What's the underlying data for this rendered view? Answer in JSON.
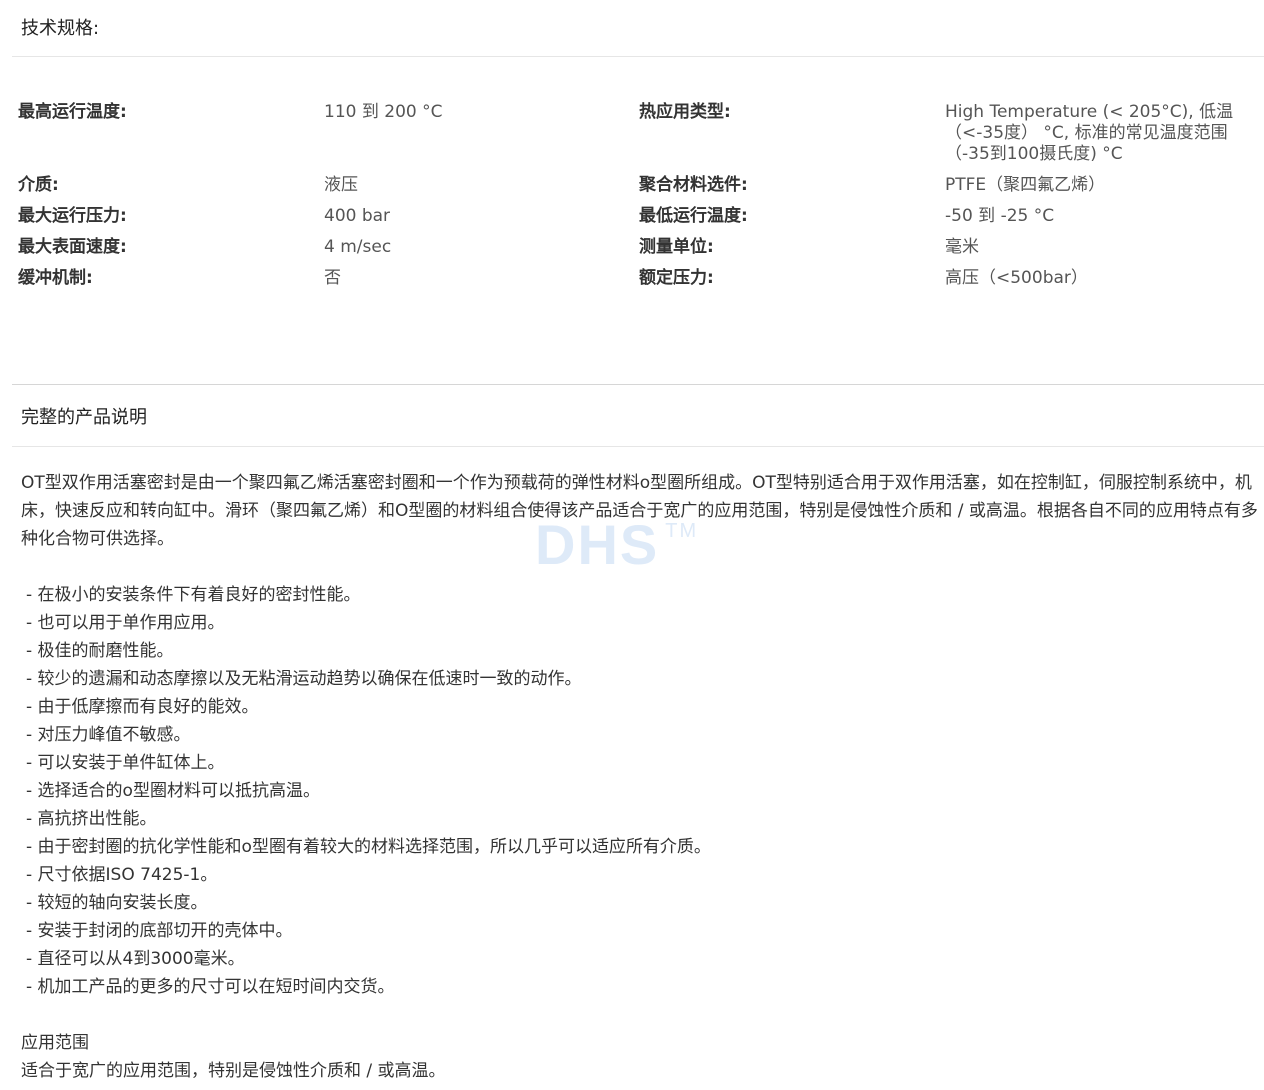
{
  "specs": {
    "heading": "技术规格:",
    "rows": [
      {
        "label1": "最高运行温度:",
        "value1": "110 到 200 °C",
        "label2": "热应用类型:",
        "value2": "High Temperature (< 205°C), 低温（<-35度） °C, 标准的常见温度范围（-35到100摄氏度) °C"
      },
      {
        "label1": "介质:",
        "value1": "液压",
        "label2": "聚合材料选件:",
        "value2": "PTFE（聚四氟乙烯）"
      },
      {
        "label1": "最大运行压力:",
        "value1": "400 bar",
        "label2": "最低运行温度:",
        "value2": "-50 到 -25 °C"
      },
      {
        "label1": "最大表面速度:",
        "value1": "4 m/sec",
        "label2": "测量单位:",
        "value2": "毫米"
      },
      {
        "label1": "缓冲机制:",
        "value1": "否",
        "label2": "额定压力:",
        "value2": "高压（<500bar）"
      }
    ]
  },
  "description": {
    "heading": "完整的产品说明",
    "intro": "OT型双作用活塞密封是由一个聚四氟乙烯活塞密封圈和一个作为预载荷的弹性材料o型圈所组成。OT型特别适合用于双作用活塞，如在控制缸，伺服控制系统中，机床，快速反应和转向缸中。滑环（聚四氟乙烯）和O型圈的材料组合使得该产品适合于宽广的应用范围，特别是侵蚀性介质和 / 或高温。根据各自不同的应用特点有多种化合物可供选择。",
    "features": [
      "- 在极小的安装条件下有着良好的密封性能。",
      "- 也可以用于单作用应用。",
      "- 极佳的耐磨性能。",
      "- 较少的遗漏和动态摩擦以及无粘滑运动趋势以确保在低速时一致的动作。",
      "- 由于低摩擦而有良好的能效。",
      "- 对压力峰值不敏感。",
      "- 可以安装于单件缸体上。",
      "- 选择适合的o型圈材料可以抵抗高温。",
      "- 高抗挤出性能。",
      "- 由于密封圈的抗化学性能和o型圈有着较大的材料选择范围，所以几乎可以适应所有介质。",
      "- 尺寸依据ISO 7425-1。",
      "- 较短的轴向安装长度。",
      "- 安装于封闭的底部切开的壳体中。",
      "- 直径可以从4到3000毫米。",
      "- 机加工产品的更多的尺寸可以在短时间内交货。"
    ],
    "application_heading": "应用范围",
    "application_text": "适合于宽广的应用范围，特别是侵蚀性介质和 / 或高温。"
  },
  "watermark": {
    "text": "DHS",
    "mark": "TM"
  },
  "colors": {
    "text": "#333333",
    "value_text": "#555555",
    "divider": "#e6e6e6",
    "watermark": "#d4e3f6"
  }
}
